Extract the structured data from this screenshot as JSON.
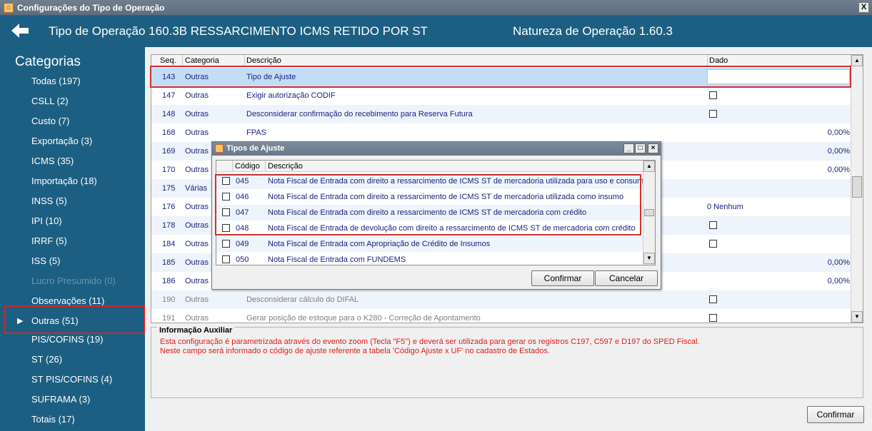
{
  "window": {
    "title": "Configurações do Tipo de Operação",
    "close_label": "X"
  },
  "header": {
    "back_icon": "arrow-left-icon",
    "operation_label": "Tipo de Operação 160.3B  RESSARCIMENTO ICMS RETIDO POR ST",
    "nature_label": "Natureza de Operação 1.60.3"
  },
  "sidebar": {
    "title": "Categorias",
    "items": [
      {
        "label": "Todas (197)"
      },
      {
        "label": "CSLL (2)"
      },
      {
        "label": "Custo (7)"
      },
      {
        "label": "Exportação (3)"
      },
      {
        "label": "ICMS (35)"
      },
      {
        "label": "Importação (18)"
      },
      {
        "label": "INSS (5)"
      },
      {
        "label": "IPI (10)"
      },
      {
        "label": "IRRF (5)"
      },
      {
        "label": "ISS (5)"
      },
      {
        "label": "Lucro Presumido (0)"
      },
      {
        "label": "Observações (11)"
      },
      {
        "label": "Outras (51)"
      },
      {
        "label": "PIS/COFINS (19)"
      },
      {
        "label": "ST (26)"
      },
      {
        "label": "ST PIS/COFINS (4)"
      },
      {
        "label": "SUFRAMA (3)"
      },
      {
        "label": "Totais (17)"
      }
    ],
    "selected_index": 12
  },
  "grid": {
    "columns": {
      "seq": "Seq.",
      "categoria": "Categoria",
      "descricao": "Descrição",
      "dado": "Dado"
    },
    "rows": [
      {
        "seq": "143",
        "cat": "Outras",
        "desc": "Tipo de Ajuste",
        "dado": ""
      },
      {
        "seq": "147",
        "cat": "Outras",
        "desc": "Exigir autorização CODIF",
        "dado": ""
      },
      {
        "seq": "148",
        "cat": "Outras",
        "desc": "Desconsiderar confirmação do recebimento para Reserva Futura",
        "dado": ""
      },
      {
        "seq": "168",
        "cat": "Outras",
        "desc": "FPAS",
        "dado": "0,00%"
      },
      {
        "seq": "169",
        "cat": "Outras",
        "desc": "",
        "dado": "0,00%"
      },
      {
        "seq": "170",
        "cat": "Outras",
        "desc": "",
        "dado": "0,00%"
      },
      {
        "seq": "175",
        "cat": "Várias",
        "desc": "",
        "dado": ""
      },
      {
        "seq": "176",
        "cat": "Outras",
        "desc": "",
        "dado": "0  Nenhum"
      },
      {
        "seq": "178",
        "cat": "Outras",
        "desc": "",
        "dado": ""
      },
      {
        "seq": "184",
        "cat": "Outras",
        "desc": "",
        "dado": ""
      },
      {
        "seq": "185",
        "cat": "Outras",
        "desc": "",
        "dado": "0,00%"
      },
      {
        "seq": "186",
        "cat": "Outras",
        "desc": "",
        "dado": "0,00%"
      },
      {
        "seq": "190",
        "cat": "Outras",
        "desc": "Desconsiderar cálculo do DIFAL",
        "dado": ""
      },
      {
        "seq": "191",
        "cat": "Outras",
        "desc": "Gerar posição de estoque para o K280 - Correção de Apontamento",
        "dado": ""
      }
    ]
  },
  "info": {
    "legend": "Informação Auxiliar",
    "line1": "Esta configuração é parametrizada através do evento zoom (Tecla \"F5\") e deverá ser utilizada para gerar os registros C197, C597 e D197 do SPED Fiscal.",
    "line2": "Neste campo será informado o código de ajuste referente a tabela 'Código Ajuste x UF' no cadastro de Estados."
  },
  "confirm_label": "Confirmar",
  "dialog": {
    "title": "Tipos de Ajuste",
    "columns": {
      "codigo": "Código",
      "descricao": "Descrição"
    },
    "rows": [
      {
        "code": "045",
        "desc": "Nota Fiscal de Entrada com direito a ressarcimento de ICMS ST de mercadoria utilizada para uso e consumo"
      },
      {
        "code": "046",
        "desc": "Nota Fiscal de Entrada com direito a ressarcimento de ICMS ST de mercadoria utilizada como insumo"
      },
      {
        "code": "047",
        "desc": "Nota Fiscal de Entrada com direito a ressarcimento de ICMS ST de mercadoria com crédito"
      },
      {
        "code": "048",
        "desc": "Nota Fiscal de Entrada de devolução com direito a ressarcimento de ICMS ST de mercadoria com crédito"
      },
      {
        "code": "049",
        "desc": "Nota Fiscal de Entrada com Apropriação de Crédito de Insumos"
      },
      {
        "code": "050",
        "desc": "Nota Fiscal de Entrada com FUNDEMS"
      }
    ],
    "confirm_label": "Confirmar",
    "cancel_label": "Cancelar"
  },
  "colors": {
    "header_bg": "#1c5f82",
    "highlight_border": "#d32f2f",
    "info_text": "#e41b1b",
    "row_text": "#1a237e"
  }
}
